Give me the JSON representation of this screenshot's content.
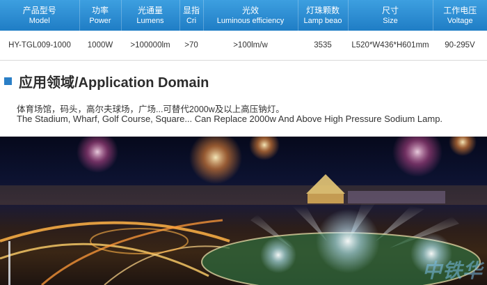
{
  "spec_table": {
    "headers": [
      {
        "cn": "产品型号",
        "en": "Model"
      },
      {
        "cn": "功率",
        "en": "Power"
      },
      {
        "cn": "光通量",
        "en": "Lumens"
      },
      {
        "cn": "显指",
        "en": "Cri"
      },
      {
        "cn": "光效",
        "en": "Luminous efficiency"
      },
      {
        "cn": "灯珠颗数",
        "en": "Lamp beao"
      },
      {
        "cn": "尺寸",
        "en": "Size"
      },
      {
        "cn": "工作电压",
        "en": "Voltage"
      }
    ],
    "row": [
      "HY-TGL009-1000",
      "1000W",
      ">100000lm",
      ">70",
      ">100lm/w",
      "3535",
      "L520*W436*H601mm",
      "90-295V"
    ]
  },
  "section": {
    "title": "应用领域/Application Domain",
    "desc_cn": "体育场馆，码头，高尔夫球场，广场...可替代2000w及以上高压钠灯。",
    "desc_en": "The Stadium, Wharf, Golf Course, Square... Can Replace 2000w And Above High Pressure Sodium Lamp."
  },
  "photo": {
    "watermark": "中铁华"
  },
  "colors": {
    "header_bg": "#2a8ad6",
    "accent": "#2a7fc6"
  }
}
